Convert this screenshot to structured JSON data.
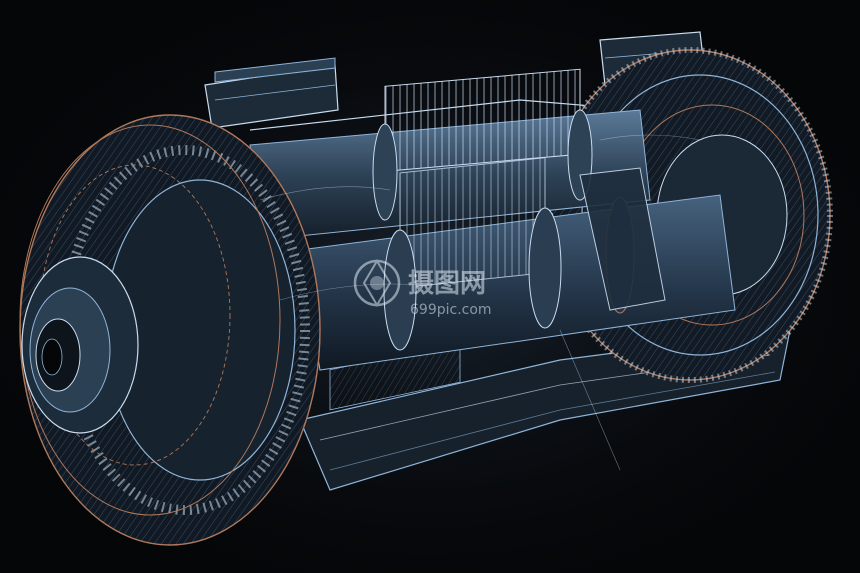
{
  "image": {
    "subject": "wireframe-render-of-gearbox-transmission-assembly",
    "background_color": "#050608",
    "palette": {
      "wire_blue": "#8fb4d8",
      "wire_light": "#c9dcef",
      "wire_copper": "#b0785a",
      "shade_dark": "#1a2633",
      "shade_mid": "#34485c"
    }
  },
  "watermark": {
    "logo_icon": "camera-aperture-icon",
    "text_cn": "摄图网",
    "text_url": "699pic.com"
  }
}
